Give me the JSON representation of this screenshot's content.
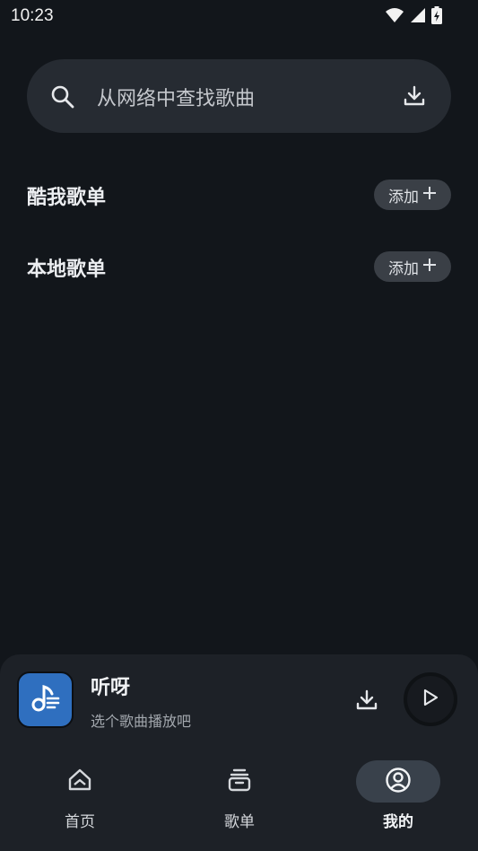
{
  "status_bar": {
    "time": "10:23",
    "icons": [
      "wifi-icon",
      "signal-icon",
      "battery-charging-icon"
    ]
  },
  "search": {
    "placeholder": "从网络中查找歌曲",
    "icon": "search-icon",
    "action_icon": "download-icon"
  },
  "sections": [
    {
      "title": "酷我歌单",
      "add_label": "添加"
    },
    {
      "title": "本地歌单",
      "add_label": "添加"
    }
  ],
  "mini_player": {
    "title": "听呀",
    "subtitle": "选个歌曲播放吧",
    "art_icon": "music-note-icon",
    "download_icon": "download-icon",
    "play_icon": "play-icon"
  },
  "bottom_nav": {
    "items": [
      {
        "label": "首页",
        "icon": "home-icon",
        "active": false
      },
      {
        "label": "歌单",
        "icon": "playlist-icon",
        "active": false
      },
      {
        "label": "我的",
        "icon": "profile-icon",
        "active": true
      }
    ]
  },
  "colors": {
    "background": "#12161b",
    "surface": "#262b32",
    "nav_surface": "#1d2127",
    "accent_art": "#2f6fbf",
    "active_pill": "#39414b"
  }
}
